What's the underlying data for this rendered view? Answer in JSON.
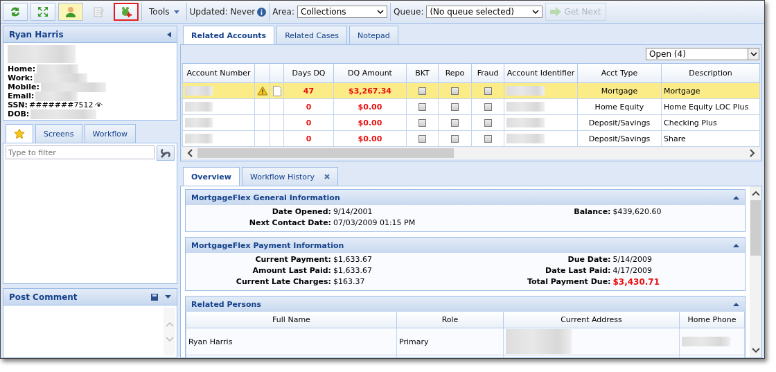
{
  "toolbar": {
    "buttons": [
      {
        "kind": "refresh",
        "selected": false,
        "disabled": false,
        "outlined": false
      },
      {
        "kind": "expand",
        "selected": false,
        "disabled": false,
        "outlined": false
      },
      {
        "kind": "person",
        "selected": true,
        "disabled": false,
        "outlined": false
      },
      {
        "kind": "notes",
        "selected": false,
        "disabled": true,
        "outlined": false
      },
      {
        "kind": "add",
        "selected": false,
        "disabled": false,
        "outlined": true
      }
    ],
    "tools_label": "Tools",
    "updated_label": "Updated: Never",
    "area_label": "Area:",
    "area_value": "Collections",
    "queue_label": "Queue:",
    "queue_value": "(No queue selected)",
    "get_next": {
      "label": "Get Next",
      "disabled": true
    }
  },
  "customer": {
    "name": "Ryan Harris",
    "fields": [
      {
        "label": "Home:"
      },
      {
        "label": "Work:"
      },
      {
        "label": "Mobile:"
      },
      {
        "label": "Email:"
      },
      {
        "label": "SSN:",
        "value": "#######7512"
      },
      {
        "label": "DOB:"
      }
    ]
  },
  "left_tabs": [
    {
      "kind": "star",
      "selected": true
    },
    {
      "kind": "text",
      "label": "Screens",
      "selected": false
    },
    {
      "kind": "text",
      "label": "Workflow",
      "selected": false
    }
  ],
  "filter": {
    "placeholder": "Type to filter"
  },
  "post_comment": {
    "title": "Post Comment"
  },
  "main_tabs": [
    {
      "label": "Related Accounts",
      "selected": true
    },
    {
      "label": "Related Cases",
      "selected": false
    },
    {
      "label": "Notepad",
      "selected": false
    }
  ],
  "status_filter": "Open (4)",
  "accounts": {
    "columns": [
      "Account Number",
      "Days DQ",
      "DQ Amount",
      "BKT",
      "Repo",
      "Fraud",
      "Account Identifier",
      "Acct Type",
      "Description"
    ],
    "rows": [
      {
        "selected": true,
        "warning": true,
        "document": true,
        "days_dq": "47",
        "dq_amount": "$3,267.34",
        "bkt": false,
        "repo": false,
        "fraud": false,
        "acct_type": "Mortgage",
        "description": "Mortgage"
      },
      {
        "selected": false,
        "warning": false,
        "document": false,
        "days_dq": "0",
        "dq_amount": "$0.00",
        "bkt": false,
        "repo": false,
        "fraud": false,
        "acct_type": "Home Equity",
        "description": "Home Equity LOC Plus"
      },
      {
        "selected": false,
        "warning": false,
        "document": false,
        "days_dq": "0",
        "dq_amount": "$0.00",
        "bkt": false,
        "repo": false,
        "fraud": false,
        "acct_type": "Deposit/Savings",
        "description": "Checking Plus"
      },
      {
        "selected": false,
        "warning": false,
        "document": false,
        "days_dq": "0",
        "dq_amount": "$0.00",
        "bkt": false,
        "repo": false,
        "fraud": false,
        "acct_type": "Deposit/Savings",
        "description": "Share"
      }
    ]
  },
  "detail_tabs": [
    {
      "label": "Overview",
      "selected": true,
      "closable": false
    },
    {
      "label": "Workflow History",
      "selected": false,
      "closable": true
    }
  ],
  "sections": [
    {
      "title": "MortgageFlex General Information",
      "left": [
        {
          "label": "Date Opened:",
          "value": "9/14/2001",
          "emphasis": false
        },
        {
          "label": "Next Contact Date:",
          "value": "07/03/2009 01:15 PM",
          "emphasis": false
        }
      ],
      "right": [
        {
          "label": "Balance:",
          "value": "$439,620.60",
          "emphasis": false
        }
      ]
    },
    {
      "title": "MortgageFlex Payment Information",
      "left": [
        {
          "label": "Current Payment:",
          "value": "$1,633.67",
          "emphasis": false
        },
        {
          "label": "Amount Last Paid:",
          "value": "$1,633.67",
          "emphasis": false
        },
        {
          "label": "Current Late Charges:",
          "value": "$163.37",
          "emphasis": false
        }
      ],
      "right": [
        {
          "label": "Due Date:",
          "value": "5/14/2009",
          "emphasis": false
        },
        {
          "label": "Date Last Paid:",
          "value": "4/17/2009",
          "emphasis": false
        },
        {
          "label": "Total Payment Due:",
          "value": "$3,430.71",
          "emphasis": true
        }
      ]
    }
  ],
  "related_persons": {
    "title": "Related Persons",
    "columns": [
      "Full Name",
      "Role",
      "Current Address",
      "Home Phone"
    ],
    "rows": [
      {
        "full_name": "Ryan Harris",
        "role": "Primary"
      }
    ]
  }
}
